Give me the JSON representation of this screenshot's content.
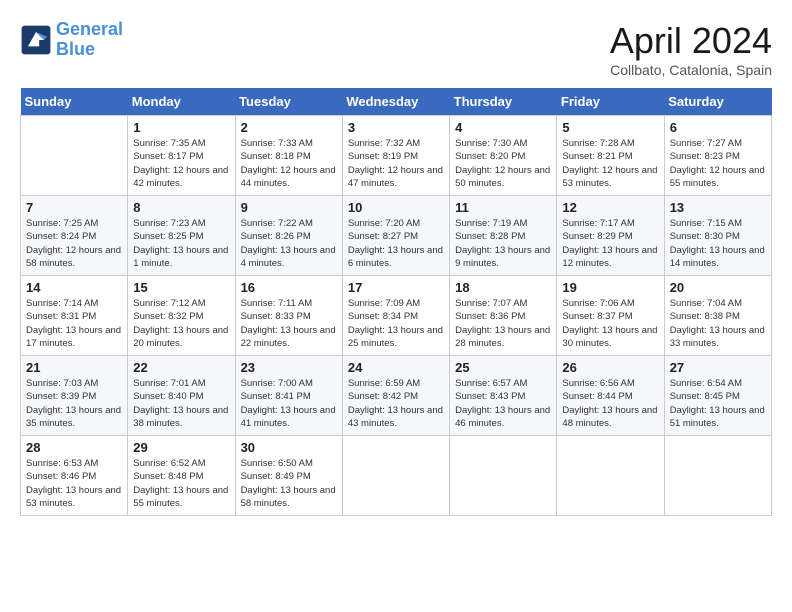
{
  "header": {
    "logo_line1": "General",
    "logo_line2": "Blue",
    "month_title": "April 2024",
    "subtitle": "Collbato, Catalonia, Spain"
  },
  "weekdays": [
    "Sunday",
    "Monday",
    "Tuesday",
    "Wednesday",
    "Thursday",
    "Friday",
    "Saturday"
  ],
  "weeks": [
    [
      {
        "day": "",
        "sunrise": "",
        "sunset": "",
        "daylight": ""
      },
      {
        "day": "1",
        "sunrise": "Sunrise: 7:35 AM",
        "sunset": "Sunset: 8:17 PM",
        "daylight": "Daylight: 12 hours and 42 minutes."
      },
      {
        "day": "2",
        "sunrise": "Sunrise: 7:33 AM",
        "sunset": "Sunset: 8:18 PM",
        "daylight": "Daylight: 12 hours and 44 minutes."
      },
      {
        "day": "3",
        "sunrise": "Sunrise: 7:32 AM",
        "sunset": "Sunset: 8:19 PM",
        "daylight": "Daylight: 12 hours and 47 minutes."
      },
      {
        "day": "4",
        "sunrise": "Sunrise: 7:30 AM",
        "sunset": "Sunset: 8:20 PM",
        "daylight": "Daylight: 12 hours and 50 minutes."
      },
      {
        "day": "5",
        "sunrise": "Sunrise: 7:28 AM",
        "sunset": "Sunset: 8:21 PM",
        "daylight": "Daylight: 12 hours and 53 minutes."
      },
      {
        "day": "6",
        "sunrise": "Sunrise: 7:27 AM",
        "sunset": "Sunset: 8:23 PM",
        "daylight": "Daylight: 12 hours and 55 minutes."
      }
    ],
    [
      {
        "day": "7",
        "sunrise": "Sunrise: 7:25 AM",
        "sunset": "Sunset: 8:24 PM",
        "daylight": "Daylight: 12 hours and 58 minutes."
      },
      {
        "day": "8",
        "sunrise": "Sunrise: 7:23 AM",
        "sunset": "Sunset: 8:25 PM",
        "daylight": "Daylight: 13 hours and 1 minute."
      },
      {
        "day": "9",
        "sunrise": "Sunrise: 7:22 AM",
        "sunset": "Sunset: 8:26 PM",
        "daylight": "Daylight: 13 hours and 4 minutes."
      },
      {
        "day": "10",
        "sunrise": "Sunrise: 7:20 AM",
        "sunset": "Sunset: 8:27 PM",
        "daylight": "Daylight: 13 hours and 6 minutes."
      },
      {
        "day": "11",
        "sunrise": "Sunrise: 7:19 AM",
        "sunset": "Sunset: 8:28 PM",
        "daylight": "Daylight: 13 hours and 9 minutes."
      },
      {
        "day": "12",
        "sunrise": "Sunrise: 7:17 AM",
        "sunset": "Sunset: 8:29 PM",
        "daylight": "Daylight: 13 hours and 12 minutes."
      },
      {
        "day": "13",
        "sunrise": "Sunrise: 7:15 AM",
        "sunset": "Sunset: 8:30 PM",
        "daylight": "Daylight: 13 hours and 14 minutes."
      }
    ],
    [
      {
        "day": "14",
        "sunrise": "Sunrise: 7:14 AM",
        "sunset": "Sunset: 8:31 PM",
        "daylight": "Daylight: 13 hours and 17 minutes."
      },
      {
        "day": "15",
        "sunrise": "Sunrise: 7:12 AM",
        "sunset": "Sunset: 8:32 PM",
        "daylight": "Daylight: 13 hours and 20 minutes."
      },
      {
        "day": "16",
        "sunrise": "Sunrise: 7:11 AM",
        "sunset": "Sunset: 8:33 PM",
        "daylight": "Daylight: 13 hours and 22 minutes."
      },
      {
        "day": "17",
        "sunrise": "Sunrise: 7:09 AM",
        "sunset": "Sunset: 8:34 PM",
        "daylight": "Daylight: 13 hours and 25 minutes."
      },
      {
        "day": "18",
        "sunrise": "Sunrise: 7:07 AM",
        "sunset": "Sunset: 8:36 PM",
        "daylight": "Daylight: 13 hours and 28 minutes."
      },
      {
        "day": "19",
        "sunrise": "Sunrise: 7:06 AM",
        "sunset": "Sunset: 8:37 PM",
        "daylight": "Daylight: 13 hours and 30 minutes."
      },
      {
        "day": "20",
        "sunrise": "Sunrise: 7:04 AM",
        "sunset": "Sunset: 8:38 PM",
        "daylight": "Daylight: 13 hours and 33 minutes."
      }
    ],
    [
      {
        "day": "21",
        "sunrise": "Sunrise: 7:03 AM",
        "sunset": "Sunset: 8:39 PM",
        "daylight": "Daylight: 13 hours and 35 minutes."
      },
      {
        "day": "22",
        "sunrise": "Sunrise: 7:01 AM",
        "sunset": "Sunset: 8:40 PM",
        "daylight": "Daylight: 13 hours and 38 minutes."
      },
      {
        "day": "23",
        "sunrise": "Sunrise: 7:00 AM",
        "sunset": "Sunset: 8:41 PM",
        "daylight": "Daylight: 13 hours and 41 minutes."
      },
      {
        "day": "24",
        "sunrise": "Sunrise: 6:59 AM",
        "sunset": "Sunset: 8:42 PM",
        "daylight": "Daylight: 13 hours and 43 minutes."
      },
      {
        "day": "25",
        "sunrise": "Sunrise: 6:57 AM",
        "sunset": "Sunset: 8:43 PM",
        "daylight": "Daylight: 13 hours and 46 minutes."
      },
      {
        "day": "26",
        "sunrise": "Sunrise: 6:56 AM",
        "sunset": "Sunset: 8:44 PM",
        "daylight": "Daylight: 13 hours and 48 minutes."
      },
      {
        "day": "27",
        "sunrise": "Sunrise: 6:54 AM",
        "sunset": "Sunset: 8:45 PM",
        "daylight": "Daylight: 13 hours and 51 minutes."
      }
    ],
    [
      {
        "day": "28",
        "sunrise": "Sunrise: 6:53 AM",
        "sunset": "Sunset: 8:46 PM",
        "daylight": "Daylight: 13 hours and 53 minutes."
      },
      {
        "day": "29",
        "sunrise": "Sunrise: 6:52 AM",
        "sunset": "Sunset: 8:48 PM",
        "daylight": "Daylight: 13 hours and 55 minutes."
      },
      {
        "day": "30",
        "sunrise": "Sunrise: 6:50 AM",
        "sunset": "Sunset: 8:49 PM",
        "daylight": "Daylight: 13 hours and 58 minutes."
      },
      {
        "day": "",
        "sunrise": "",
        "sunset": "",
        "daylight": ""
      },
      {
        "day": "",
        "sunrise": "",
        "sunset": "",
        "daylight": ""
      },
      {
        "day": "",
        "sunrise": "",
        "sunset": "",
        "daylight": ""
      },
      {
        "day": "",
        "sunrise": "",
        "sunset": "",
        "daylight": ""
      }
    ]
  ]
}
